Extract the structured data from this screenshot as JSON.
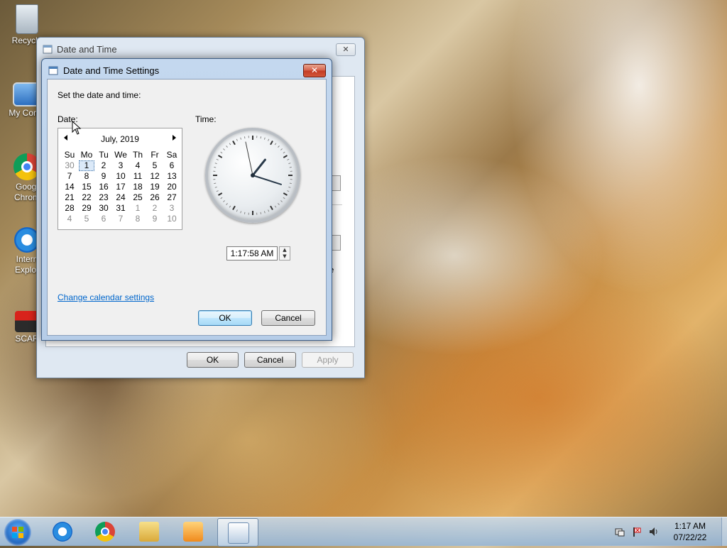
{
  "desktop": {
    "icons": [
      {
        "label_lines": [
          "Recycle"
        ],
        "icon": "recycle-bin-icon"
      },
      {
        "label_lines": [
          "My Comp"
        ],
        "icon": "my-computer-icon"
      },
      {
        "label_lines": [
          "Googl",
          "Chrom"
        ],
        "icon": "chrome-icon"
      },
      {
        "label_lines": [
          "Intern",
          "Explor"
        ],
        "icon": "internet-explorer-icon"
      },
      {
        "label_lines": [
          "SCAR"
        ],
        "icon": "mario-icon"
      }
    ]
  },
  "back_window": {
    "title": "Date and Time",
    "partial_text": "ne",
    "buttons": {
      "ok": "OK",
      "cancel": "Cancel",
      "apply": "Apply"
    }
  },
  "dialog": {
    "title": "Date and Time Settings",
    "instruction": "Set the date and time:",
    "date_label": "Date:",
    "time_label": "Time:",
    "calendar": {
      "month_year": "July, 2019",
      "weekdays": [
        "Su",
        "Mo",
        "Tu",
        "We",
        "Th",
        "Fr",
        "Sa"
      ],
      "weeks": [
        [
          "30",
          "1",
          "2",
          "3",
          "4",
          "5",
          "6"
        ],
        [
          "7",
          "8",
          "9",
          "10",
          "11",
          "12",
          "13"
        ],
        [
          "14",
          "15",
          "16",
          "17",
          "18",
          "19",
          "20"
        ],
        [
          "21",
          "22",
          "23",
          "24",
          "25",
          "26",
          "27"
        ],
        [
          "28",
          "29",
          "30",
          "31",
          "1",
          "2",
          "3"
        ],
        [
          "4",
          "5",
          "6",
          "7",
          "8",
          "9",
          "10"
        ]
      ],
      "selected_day": "1"
    },
    "clock": {
      "hour": 1,
      "minute": 17,
      "second": 58
    },
    "time_value": "1:17:58 AM",
    "change_calendar_link": "Change calendar settings",
    "ok": "OK",
    "cancel": "Cancel"
  },
  "taskbar": {
    "apps": [
      "internet-explorer-icon",
      "chrome-icon",
      "file-explorer-icon",
      "media-player-icon",
      "date-time-icon"
    ],
    "clock_time": "1:17 AM",
    "clock_date": "07/22/22"
  }
}
